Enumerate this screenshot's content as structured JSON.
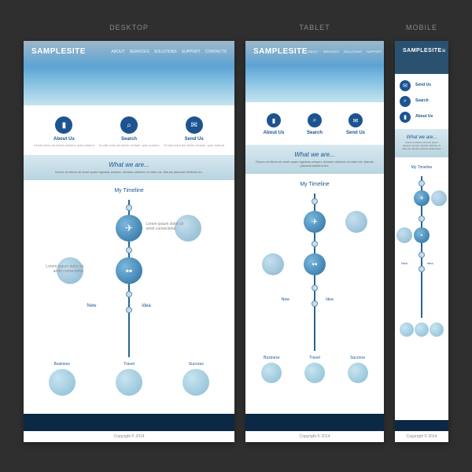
{
  "labels": {
    "desktop": "DESKTOP",
    "tablet": "TABLET",
    "mobile": "MOBILE"
  },
  "site": {
    "name": "SAMPLESITE",
    "nav": [
      "ABOUT",
      "SERVICES",
      "SOLUTIONS",
      "SUPPORT",
      "CONTACTS"
    ]
  },
  "features": [
    {
      "icon": "book",
      "title": "About Us",
      "desc": "Ut wisi enim ad minim veniam, quis nostrud"
    },
    {
      "icon": "search",
      "title": "Search",
      "desc": "Ut wisi enim ad minim veniam, quis nostrud"
    },
    {
      "icon": "mail",
      "title": "Send Us",
      "desc": "Ut wisi enim ad minim veniam, quis nostrud"
    }
  ],
  "what": {
    "title": "What we are...",
    "desc": "Donec eu libero sit amet quam egestas semper. Aenean ultricies mi vitae est. Mauris placerat eleifend leo."
  },
  "timeline": {
    "title": "My Timeline",
    "left": "New",
    "right": "Idea"
  },
  "biz": [
    "Business",
    "Travel",
    "Success"
  ],
  "copy": "Copyright © 2014"
}
